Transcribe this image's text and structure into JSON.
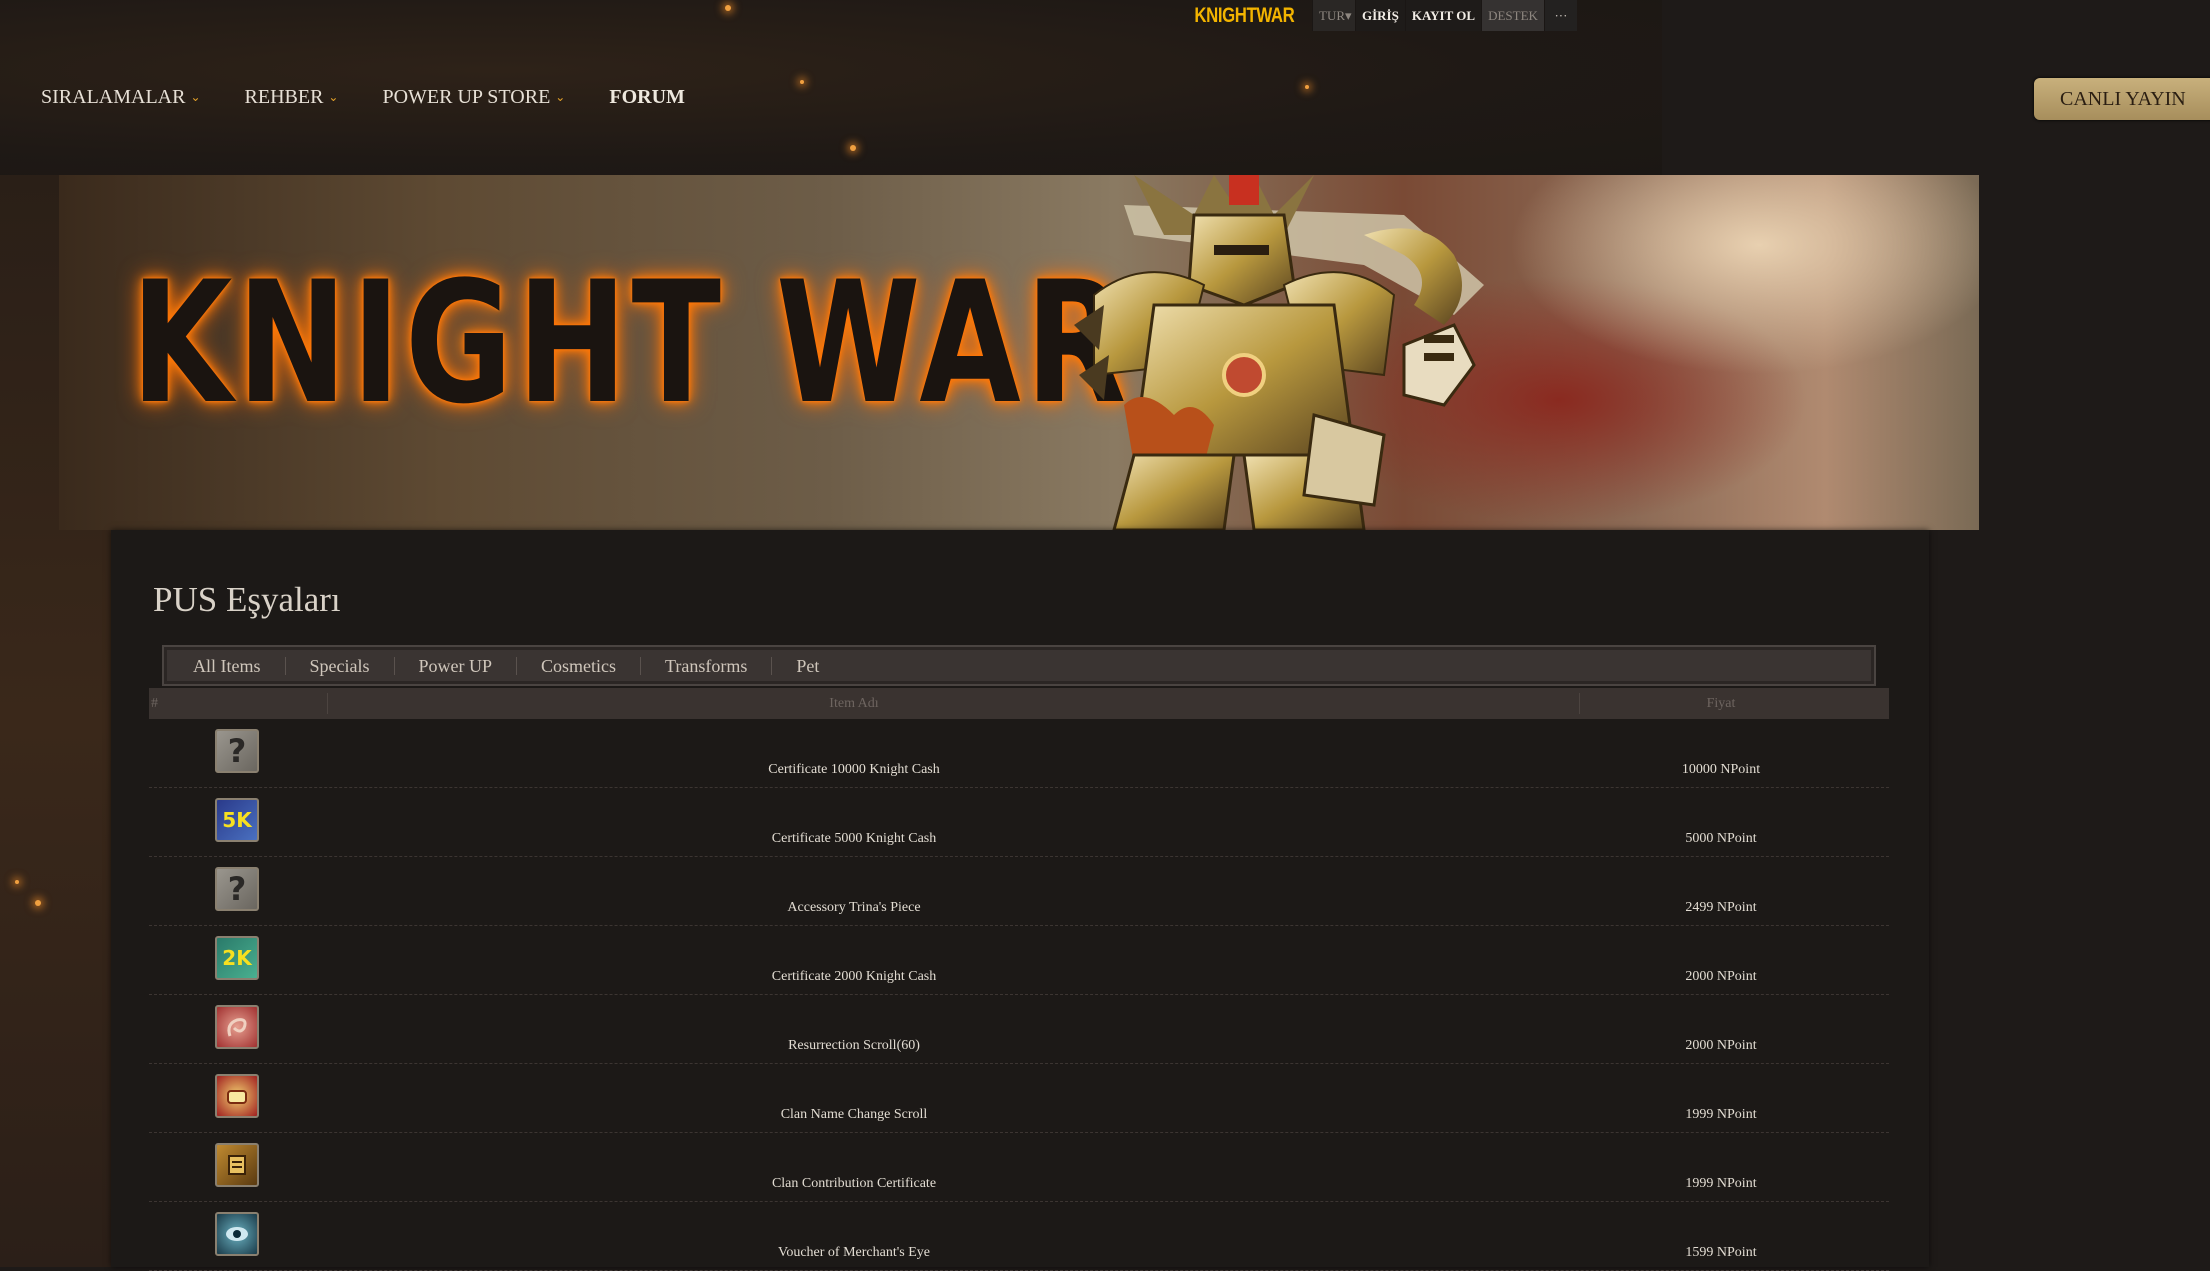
{
  "topbar": {
    "brand": "KNIGHTWAR",
    "lang": "TUR▾",
    "login": "GİRİŞ",
    "register": "KAYIT OL",
    "support": "DESTEK",
    "more": "···"
  },
  "nav": {
    "items": [
      {
        "label": "SIRALAMALAR",
        "caret": "⌄"
      },
      {
        "label": "REHBER",
        "caret": "⌄"
      },
      {
        "label": "POWER UP STORE",
        "caret": "⌄"
      },
      {
        "label": "FORUM"
      }
    ],
    "live_button": "CANLI YAYIN"
  },
  "banner": {
    "logo": "KNIGHT WAR"
  },
  "page": {
    "title": "PUS Eşyaları",
    "tabs": [
      "All Items",
      "Specials",
      "Power UP",
      "Cosmetics",
      "Transforms",
      "Pet"
    ]
  },
  "table": {
    "headers": {
      "index": "#",
      "name": "Item Adı",
      "price": "Fiyat"
    },
    "rows": [
      {
        "icon": "question-icon",
        "icon_text": "?",
        "name": "Certificate 10000 Knight Cash",
        "price": "10000 NPoint"
      },
      {
        "icon": "cash-5k-icon",
        "icon_text": "5K",
        "name": "Certificate 5000 Knight Cash",
        "price": "5000 NPoint"
      },
      {
        "icon": "question-icon",
        "icon_text": "?",
        "name": "Accessory Trina's Piece",
        "price": "2499 NPoint"
      },
      {
        "icon": "cash-2k-icon",
        "icon_text": "2K",
        "name": "Certificate 2000 Knight Cash",
        "price": "2000 NPoint"
      },
      {
        "icon": "resurrection-scroll-icon",
        "icon_text": "",
        "name": "Resurrection Scroll(60)",
        "price": "2000 NPoint"
      },
      {
        "icon": "clan-scroll-icon",
        "icon_text": "",
        "name": "Clan Name Change Scroll",
        "price": "1999 NPoint"
      },
      {
        "icon": "certificate-icon",
        "icon_text": "",
        "name": "Clan Contribution Certificate",
        "price": "1999 NPoint"
      },
      {
        "icon": "eye-icon",
        "icon_text": "",
        "name": "Voucher of Merchant's Eye",
        "price": "1599 NPoint"
      }
    ]
  },
  "colors": {
    "brand": "#f3b400",
    "accent": "#e3a12a",
    "live_button": "#b89e6a"
  }
}
